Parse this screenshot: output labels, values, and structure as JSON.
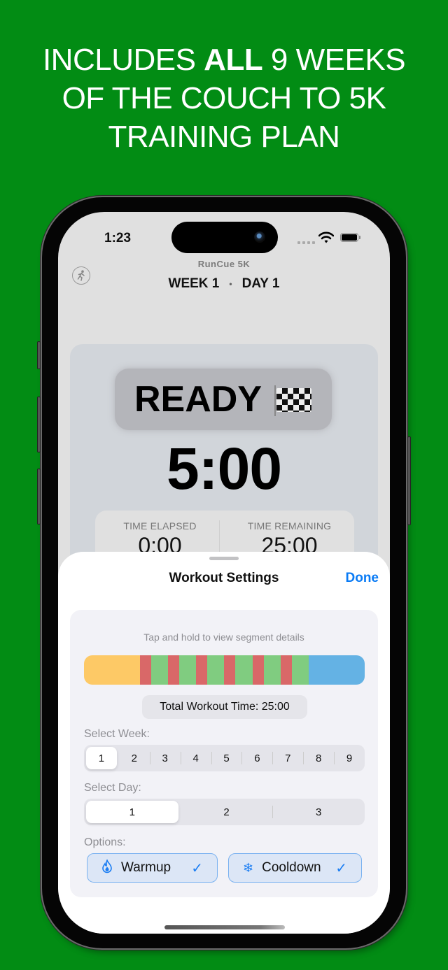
{
  "headline": {
    "prefix": "INCLUDES ",
    "bold": "ALL",
    "line1_suffix": " 9 WEEKS",
    "line2": "OF THE COUCH TO 5K",
    "line3": "TRAINING PLAN"
  },
  "status_bar": {
    "time": "1:23",
    "icons": [
      "signal-dots-icon",
      "wifi-icon",
      "battery-icon"
    ]
  },
  "header": {
    "app_name": "RunCue 5K",
    "week": "WEEK 1",
    "separator": "•",
    "day": "DAY 1",
    "run_icon": "running-figure-icon"
  },
  "timer": {
    "phase": "READY",
    "phase_icon": "checkered-flag-icon",
    "countdown": "5:00",
    "elapsed_label": "TIME ELAPSED",
    "elapsed_value": "0:00",
    "remaining_label": "TIME REMAINING",
    "remaining_value": "25:00"
  },
  "sheet": {
    "title": "Workout Settings",
    "done_label": "Done",
    "hint": "Tap and hold to view segment details",
    "segments": [
      {
        "type": "warmup",
        "minutes": 5,
        "color": "#fdc966"
      },
      {
        "type": "run",
        "minutes": 1,
        "color": "#d96868"
      },
      {
        "type": "walk",
        "minutes": 1.5,
        "color": "#80cc80"
      },
      {
        "type": "run",
        "minutes": 1,
        "color": "#d96868"
      },
      {
        "type": "walk",
        "minutes": 1.5,
        "color": "#80cc80"
      },
      {
        "type": "run",
        "minutes": 1,
        "color": "#d96868"
      },
      {
        "type": "walk",
        "minutes": 1.5,
        "color": "#80cc80"
      },
      {
        "type": "run",
        "minutes": 1,
        "color": "#d96868"
      },
      {
        "type": "walk",
        "minutes": 1.5,
        "color": "#80cc80"
      },
      {
        "type": "run",
        "minutes": 1,
        "color": "#d96868"
      },
      {
        "type": "walk",
        "minutes": 1.5,
        "color": "#80cc80"
      },
      {
        "type": "run",
        "minutes": 1,
        "color": "#d96868"
      },
      {
        "type": "walk",
        "minutes": 1.5,
        "color": "#80cc80"
      },
      {
        "type": "cooldown",
        "minutes": 5,
        "color": "#64b2e4"
      }
    ],
    "total_label": "Total Workout Time: 25:00",
    "week_label": "Select Week:",
    "weeks": [
      "1",
      "2",
      "3",
      "4",
      "5",
      "6",
      "7",
      "8",
      "9"
    ],
    "selected_week": "1",
    "day_label": "Select Day:",
    "days": [
      "1",
      "2",
      "3"
    ],
    "selected_day": "1",
    "options_label": "Options:",
    "options": [
      {
        "label": "Warmup",
        "icon": "flame-icon",
        "checked": true
      },
      {
        "label": "Cooldown",
        "icon": "snowflake-icon",
        "checked": true
      }
    ]
  },
  "colors": {
    "background": "#028c14",
    "accent": "#0a7bf5"
  }
}
